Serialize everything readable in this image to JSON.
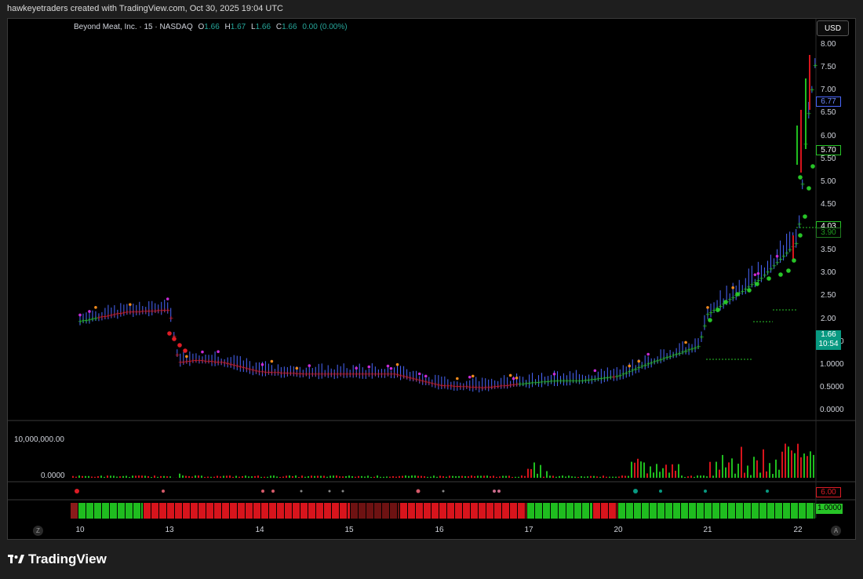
{
  "caption": "hawkeyetraders created with TradingView.com, Oct 30, 2025 19:04 UTC",
  "legend": {
    "symbol": "Beyond Meat, Inc. · 15 · NASDAQ",
    "o_label": "O",
    "o": "1.66",
    "h_label": "H",
    "h": "1.67",
    "l_label": "L",
    "l": "1.66",
    "c_label": "C",
    "c": "1.66",
    "change": "0.00 (0.00%)"
  },
  "currency": "USD",
  "price_axis": [
    "8.00",
    "7.50",
    "7.00",
    "6.50",
    "6.00",
    "5.50",
    "5.00",
    "4.50",
    "4.00",
    "3.50",
    "3.00",
    "2.50",
    "2.00",
    "1.5000",
    "1.0000",
    "0.5000",
    "0.0000"
  ],
  "price_badges": [
    {
      "text": "6.77",
      "price": 6.77,
      "style": "blue"
    },
    {
      "text": "5.70",
      "price": 5.7,
      "style": "green"
    },
    {
      "text": "4.03",
      "price": 4.03,
      "style": "green"
    },
    {
      "text": "3.90",
      "price": 3.9,
      "style": "greenmuted"
    }
  ],
  "last_price": {
    "value": "1.66",
    "countdown": "10:54"
  },
  "volume_axis": [
    "10,000,000.00",
    "0.0000"
  ],
  "dots_panel_badge": "6.00",
  "bars_panel_badge": "1.0000",
  "x_axis": [
    "10",
    "13",
    "14",
    "15",
    "16",
    "17",
    "20",
    "21",
    "22"
  ],
  "logo_text": "TradingView",
  "colors": {
    "up": "#1fbd1f",
    "down": "#d8141c",
    "green": "#27c427",
    "red": "#dd1c25",
    "purple": "#c92ad6",
    "orange": "#f08a1c",
    "blue": "#4a67ff",
    "teal": "#089981",
    "text": "#d1d4dc"
  },
  "chart_data": {
    "type": "line",
    "title": "Beyond Meat, Inc. · 15 · NASDAQ",
    "ylim": [
      0,
      8
    ],
    "x": [
      "10",
      "13",
      "14",
      "15",
      "16",
      "17",
      "20",
      "21",
      "22"
    ],
    "series": [
      {
        "name": "price",
        "x_days": [
          0,
          0.5,
          1,
          1.1,
          1.3,
          1.6,
          2,
          2.5,
          3,
          3.5,
          4,
          4.5,
          5,
          5.3,
          5.6,
          6,
          6.3,
          6.6,
          6.9,
          7,
          7.3,
          7.6,
          7.8,
          8,
          8.1,
          8.2,
          8.3
        ],
        "values": [
          1.95,
          2.15,
          2.2,
          1.05,
          1.1,
          1.05,
          0.85,
          0.8,
          0.8,
          0.8,
          0.55,
          0.5,
          0.6,
          0.65,
          0.65,
          0.75,
          1.0,
          1.2,
          1.4,
          2.1,
          2.5,
          2.9,
          3.3,
          3.7,
          6.2,
          7.7,
          1.66
        ]
      }
    ],
    "volume_series": {
      "name": "volume",
      "max_label": "10,000,000.00"
    }
  }
}
